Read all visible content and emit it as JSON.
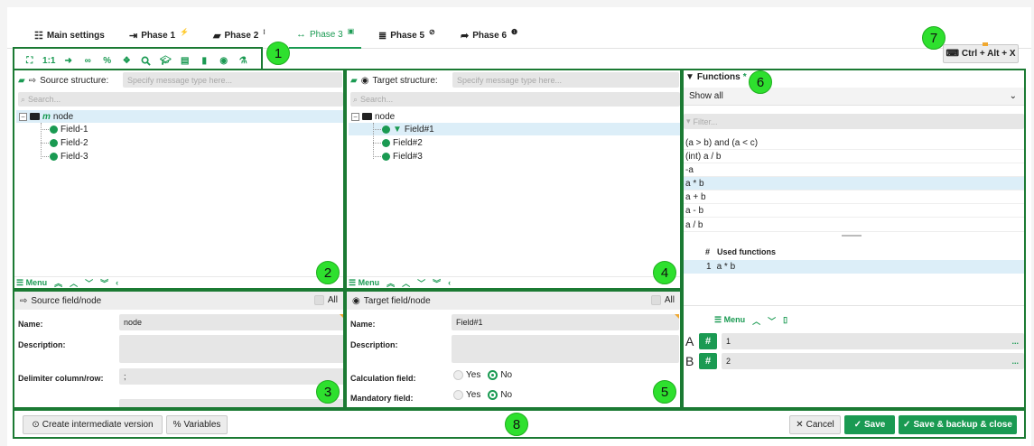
{
  "tabs": [
    {
      "label": "Main settings",
      "icon": "list-icon",
      "mark": ""
    },
    {
      "label": "Phase 1",
      "icon": "arrow-in-icon",
      "mark": "⚡"
    },
    {
      "label": "Phase 2",
      "icon": "coffee-icon",
      "mark": "⁝"
    },
    {
      "label": "Phase 3",
      "icon": "arrows-horizontal-icon",
      "mark": "▣"
    },
    {
      "label": "Phase 5",
      "icon": "stack-icon",
      "mark": "⊘"
    },
    {
      "label": "Phase 6",
      "icon": "share-icon",
      "mark": "❶"
    }
  ],
  "toolbar_icons": [
    "expand-icon",
    "one-to-one-icon",
    "arrow-right-icon",
    "link-icon",
    "percent-icon",
    "cubes-icon",
    "search-icon",
    "graduation-icon",
    "list-box-icon",
    "file-icon",
    "eye-icon",
    "flask-icon"
  ],
  "toolbar_labels": {
    "one_to_one": "1:1"
  },
  "shortcut_button": "Ctrl + Alt + X",
  "numbers": [
    "1",
    "2",
    "3",
    "4",
    "5",
    "6",
    "7",
    "8"
  ],
  "source": {
    "title": "Source structure:",
    "placeholder": "Specify message type here...",
    "search": "Search...",
    "root": "node",
    "root_mark": "m",
    "fields": [
      "Field-1",
      "Field-2",
      "Field-3"
    ]
  },
  "target": {
    "title": "Target structure:",
    "placeholder": "Specify message type here...",
    "search": "Search...",
    "root": "node",
    "fields": [
      "Field#1",
      "Field#2",
      "Field#3"
    ]
  },
  "menu_label": "Menu",
  "source_props": {
    "title": "Source field/node",
    "all": "All",
    "name_label": "Name:",
    "name_value": "node",
    "desc_label": "Description:",
    "delim_label": "Delimiter column/row:",
    "delim_value": ";"
  },
  "target_props": {
    "title": "Target field/node",
    "all": "All",
    "name_label": "Name:",
    "name_value": "Field#1",
    "desc_label": "Description:",
    "calc_label": "Calculation field:",
    "mand_label": "Mandatory field:",
    "yes": "Yes",
    "no": "No"
  },
  "functions": {
    "title": "Functions",
    "asterisk": "*",
    "filter_select": "Show all",
    "filter_placeholder": "Filter...",
    "items": [
      "(a > b) and (a < c)",
      "(int) a / b",
      "-a",
      "a * b",
      "a + b",
      "a - b",
      "a / b"
    ],
    "selected_index": 3,
    "used_header_num": "#",
    "used_header": "Used functions",
    "used": [
      {
        "num": "1",
        "name": "a * b"
      }
    ],
    "menu": "Menu",
    "vars": [
      {
        "label": "A",
        "value": "1"
      },
      {
        "label": "B",
        "value": "2"
      }
    ],
    "ellipsis": "..."
  },
  "bottom": {
    "create_version": "Create intermediate version",
    "variables": "Variables",
    "cancel": "Cancel",
    "save": "Save",
    "save_backup": "Save & backup & close"
  },
  "colors": {
    "accent": "#1a9a52",
    "highlight_border": "#1b7a33",
    "badge": "#2ee02e",
    "selection": "#dceef8"
  }
}
